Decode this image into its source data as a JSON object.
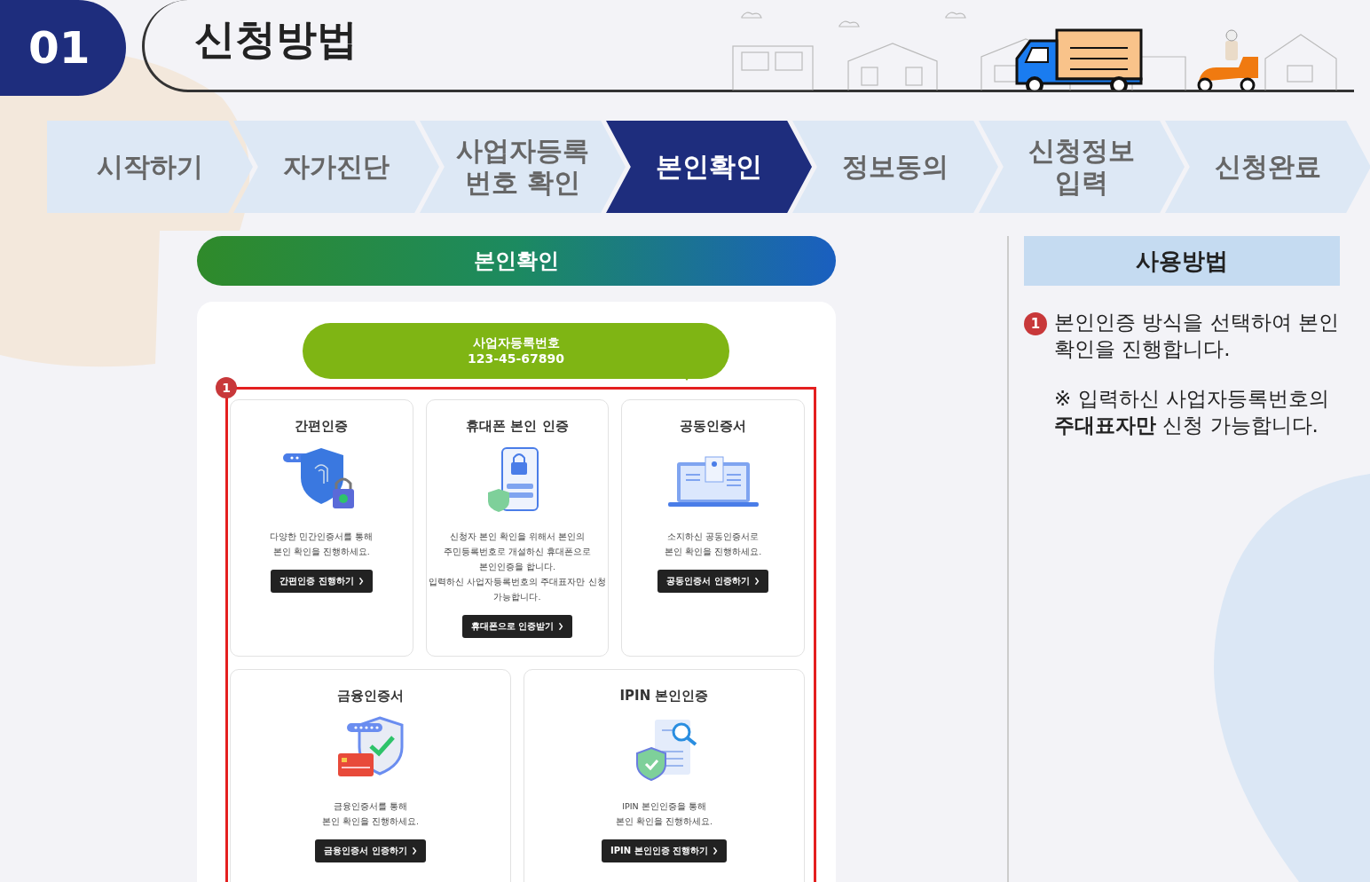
{
  "header": {
    "number": "01",
    "title": "신청방법"
  },
  "steps": [
    {
      "label": "시작하기",
      "selected": false
    },
    {
      "label": "자가진단",
      "selected": false
    },
    {
      "label": "사업자등록 번호 확인",
      "selected": false
    },
    {
      "label": "본인확인",
      "selected": true
    },
    {
      "label": "정보동의",
      "selected": false
    },
    {
      "label": "신청정보 입력",
      "selected": false
    },
    {
      "label": "신청완료",
      "selected": false
    }
  ],
  "section_title": "본인확인",
  "business": {
    "label": "사업자등록번호",
    "number": "123-45-67890"
  },
  "marker": "1",
  "methods": [
    {
      "title": "간편인증",
      "kind": "fingerprint",
      "description": [
        "다양한 민간인증서를 통해",
        "본인 확인을 진행하세요."
      ],
      "button": "간편인증 진행하기"
    },
    {
      "title": "휴대폰 본인 인증",
      "kind": "phone",
      "description": [
        "신청자 본인 확인을 위해서 본인의",
        "주민등록번호로 개설하신 휴대폰으로",
        "본인인증을 합니다.",
        "입력하신 사업자등록번호의 주대표자만 신청",
        "가능합니다."
      ],
      "button": "휴대폰으로 인증받기"
    },
    {
      "title": "공동인증서",
      "kind": "laptop",
      "description": [
        "소지하신 공동인증서로",
        "본인 확인을 진행하세요."
      ],
      "button": "공동인증서 인증하기"
    },
    {
      "title": "금융인증서",
      "kind": "card",
      "description": [
        "금융인증서를 통해",
        "본인 확인을 진행하세요."
      ],
      "button": "금융인증서 인증하기"
    },
    {
      "title": "IPIN 본인인증",
      "kind": "document",
      "description": [
        "IPIN 본인인증을 통해",
        "본인 확인을 진행하세요."
      ],
      "button": "IPIN 본인인증 진행하기"
    }
  ],
  "guide": {
    "title": "사용방법",
    "items": [
      {
        "marker": "1",
        "text": "본인인증 방식을 선택하여 본인 확인을 진행합니다."
      }
    ],
    "note": "※ 입력하신 사업자등록번호의 **주대표자만** 신청 가능합니다."
  }
}
